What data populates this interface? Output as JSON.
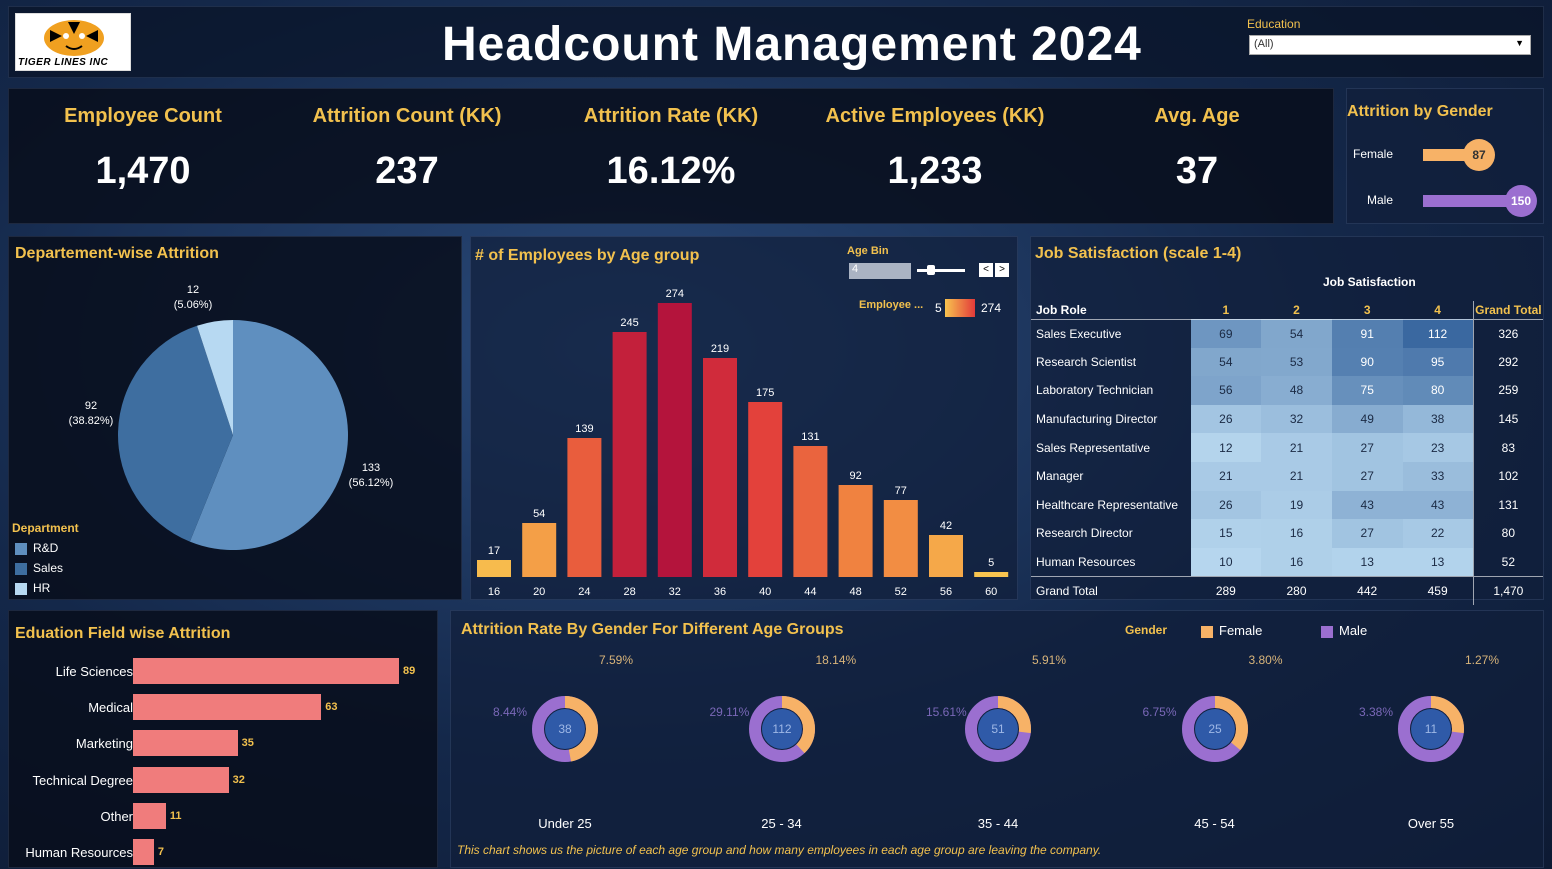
{
  "header": {
    "logo_text": "TIGER LINES INC",
    "title": "Headcount Management 2024",
    "filter_label": "Education",
    "filter_value": "(All)"
  },
  "kpis": [
    {
      "label": "Employee Count",
      "value": "1,470"
    },
    {
      "label": "Attrition Count (KK)",
      "value": "237"
    },
    {
      "label": "Attrition Rate (KK)",
      "value": "16.12%"
    },
    {
      "label": "Active Employees (KK)",
      "value": "1,233"
    },
    {
      "label": "Avg. Age",
      "value": "37"
    }
  ],
  "gender_attrition": {
    "title": "Attrition by Gender",
    "rows": [
      {
        "label": "Female",
        "value": 87,
        "color": "#f7b267"
      },
      {
        "label": "Male",
        "value": 150,
        "color": "#9b6fd0"
      }
    ]
  },
  "dept": {
    "title": "Departement-wise Attrition",
    "legend_title": "Department",
    "legend": [
      {
        "label": "R&D",
        "color": "#5f8fbf"
      },
      {
        "label": "Sales",
        "color": "#3e6ea0"
      },
      {
        "label": "HR",
        "color": "#b7d9f2"
      }
    ],
    "slices": [
      {
        "label": "R&D",
        "count": "133",
        "pct": "(56.12%)",
        "value": 133,
        "color": "#5f8fbf"
      },
      {
        "label": "Sales",
        "count": "92",
        "pct": "(38.82%)",
        "value": 92,
        "color": "#3e6ea0"
      },
      {
        "label": "HR",
        "count": "12",
        "pct": "(5.06%)",
        "value": 12,
        "color": "#b7d9f2"
      }
    ]
  },
  "age": {
    "title": "# of Employees by Age group",
    "bin_label": "Age Bin",
    "bin_value": "4",
    "legend_label": "Employee ...",
    "legend_min": "5",
    "legend_max": "274",
    "prev": "<",
    "next": ">"
  },
  "chart_data": {
    "type": "bar",
    "title": "# of Employees by Age group",
    "categories": [
      "16",
      "20",
      "24",
      "28",
      "32",
      "36",
      "40",
      "44",
      "48",
      "52",
      "56",
      "60"
    ],
    "values": [
      17,
      54,
      139,
      245,
      274,
      219,
      175,
      131,
      92,
      77,
      42,
      5
    ],
    "ylim": [
      0,
      274
    ]
  },
  "job": {
    "title": "Job Satisfaction (scale 1-4)",
    "header_group": "Job Satisfaction",
    "col_role": "Job Role",
    "cols": [
      "1",
      "2",
      "3",
      "4"
    ],
    "col_total": "Grand Total",
    "rows": [
      {
        "role": "Sales Executive",
        "v": [
          69,
          54,
          91,
          112
        ],
        "total": "326"
      },
      {
        "role": "Research Scientist",
        "v": [
          54,
          53,
          90,
          95
        ],
        "total": "292"
      },
      {
        "role": "Laboratory Technician",
        "v": [
          56,
          48,
          75,
          80
        ],
        "total": "259"
      },
      {
        "role": "Manufacturing Director",
        "v": [
          26,
          32,
          49,
          38
        ],
        "total": "145"
      },
      {
        "role": "Sales Representative",
        "v": [
          12,
          21,
          27,
          23
        ],
        "total": "83"
      },
      {
        "role": "Manager",
        "v": [
          21,
          21,
          27,
          33
        ],
        "total": "102"
      },
      {
        "role": "Healthcare Representative",
        "v": [
          26,
          19,
          43,
          43
        ],
        "total": "131"
      },
      {
        "role": "Research Director",
        "v": [
          15,
          16,
          27,
          22
        ],
        "total": "80"
      },
      {
        "role": "Human Resources",
        "v": [
          10,
          16,
          13,
          13
        ],
        "total": "52"
      }
    ],
    "grand": {
      "label": "Grand Total",
      "v": [
        "289",
        "280",
        "442",
        "459"
      ],
      "total": "1,470"
    }
  },
  "edu": {
    "title": "Eduation Field wise Attrition",
    "rows": [
      {
        "label": "Life Sciences",
        "value": 89
      },
      {
        "label": "Medical",
        "value": 63
      },
      {
        "label": "Marketing",
        "value": 35
      },
      {
        "label": "Technical Degree",
        "value": 32
      },
      {
        "label": "Other",
        "value": 11
      },
      {
        "label": "Human Resources",
        "value": 7
      }
    ]
  },
  "gender_age": {
    "title": "Attrition Rate By Gender For Different Age Groups",
    "legend_title": "Gender",
    "legend": [
      {
        "label": "Female",
        "color": "#f7b267"
      },
      {
        "label": "Male",
        "color": "#9b6fd0"
      }
    ],
    "groups": [
      {
        "label": "Under 25",
        "center": "38",
        "female_pct": "7.59%",
        "male_pct": "8.44%",
        "female_frac": 0.47
      },
      {
        "label": "25 - 34",
        "center": "112",
        "female_pct": "18.14%",
        "male_pct": "29.11%",
        "female_frac": 0.38
      },
      {
        "label": "35 - 44",
        "center": "51",
        "female_pct": "5.91%",
        "male_pct": "15.61%",
        "female_frac": 0.27
      },
      {
        "label": "45 - 54",
        "center": "25",
        "female_pct": "3.80%",
        "male_pct": "6.75%",
        "female_frac": 0.36
      },
      {
        "label": "Over 55",
        "center": "11",
        "female_pct": "1.27%",
        "male_pct": "3.38%",
        "female_frac": 0.27
      }
    ],
    "note": "This chart shows us the picture of each age group and how many employees in each age group are  leaving the company."
  }
}
